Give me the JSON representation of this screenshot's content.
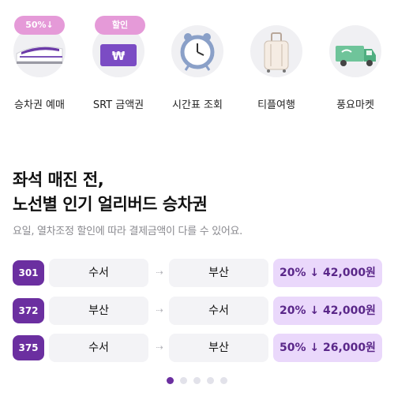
{
  "menu": [
    {
      "label": "승차권 예매",
      "badge": "50%↓",
      "icon": "ktx-train-icon"
    },
    {
      "label": "SRT 금액권",
      "badge": "할인",
      "icon": "won-card-icon"
    },
    {
      "label": "시간표 조회",
      "badge": "",
      "icon": "alarm-clock-icon"
    },
    {
      "label": "티플여행",
      "badge": "",
      "icon": "suitcase-icon"
    },
    {
      "label": "풍요마켓",
      "badge": "",
      "icon": "delivery-truck-icon"
    }
  ],
  "section": {
    "title_line1": "좌석 매진 전,",
    "title_line2": "노선별 인기 얼리버드 승차권",
    "description": "요일, 열차조정 할인에 따라 결제금액이 다를 수 있어요."
  },
  "routes": [
    {
      "train": "301",
      "from": "수서",
      "arrow": "⇢",
      "to": "부산",
      "price": "20% ↓ 42,000원"
    },
    {
      "train": "372",
      "from": "부산",
      "arrow": "⇢",
      "to": "수서",
      "price": "20% ↓ 42,000원"
    },
    {
      "train": "375",
      "from": "수서",
      "arrow": "⇢",
      "to": "부산",
      "price": "50% ↓ 26,000원"
    }
  ],
  "pagination": {
    "total": 5,
    "active_index": 0
  },
  "colors": {
    "accent": "#6b2fa0",
    "badge": "#e59ad8",
    "price_bg": "#ead8fb",
    "chip_bg": "#f3f3f6"
  }
}
